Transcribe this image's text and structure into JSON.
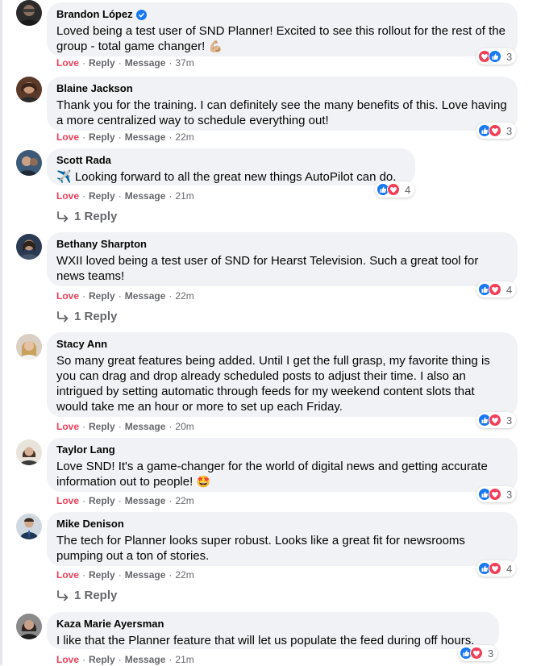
{
  "actions": {
    "love": "Love",
    "reply": "Reply",
    "message": "Message"
  },
  "comments": [
    {
      "author": "Brandon López",
      "verified": true,
      "text": "Loved being a test user of SND Planner! Excited to see this rollout for the rest of the group - total game changer!",
      "emoji": "💪🏼",
      "time": "37m",
      "reaction_order": [
        "heart",
        "like"
      ],
      "reaction_count": "3",
      "replies": ""
    },
    {
      "author": "Blaine Jackson",
      "text": "Thank you for the training. I can definitely see the many benefits of this. Love having a more centralized way to schedule everything out!",
      "time": "22m",
      "reaction_order": [
        "like",
        "heart"
      ],
      "reaction_count": "3",
      "replies": ""
    },
    {
      "author": "Scott Rada",
      "text": "✈️ Looking forward to all the great new things AutoPilot can do.",
      "time": "21m",
      "reaction_order": [
        "like",
        "heart"
      ],
      "reaction_count": "4",
      "replies": "1 Reply"
    },
    {
      "author": "Bethany Sharpton",
      "text": "WXII loved being a test user of SND for Hearst Television. Such a great tool for news teams!",
      "time": "22m",
      "reaction_order": [
        "like",
        "heart"
      ],
      "reaction_count": "4",
      "replies": "1 Reply"
    },
    {
      "author": "Stacy Ann",
      "text": "So many great features being added. Until I get the full grasp, my favorite thing is you can drag and drop already scheduled posts to adjust their time. I also an intrigued by setting automatic through feeds for my weekend content slots that would take me an hour or more to set up each Friday.",
      "time": "20m",
      "reaction_order": [
        "like",
        "heart"
      ],
      "reaction_count": "3",
      "replies": ""
    },
    {
      "author": "Taylor Lang",
      "text": "Love SND! It's a game-changer for the world of digital news and getting accurate information out to people!",
      "emoji": "🤩",
      "time": "22m",
      "reaction_order": [
        "like",
        "heart"
      ],
      "reaction_count": "3",
      "replies": ""
    },
    {
      "author": "Mike Denison",
      "text": "The tech for Planner looks super robust. Looks like a great fit for newsrooms pumping out a ton of stories.",
      "time": "22m",
      "reaction_order": [
        "like",
        "heart"
      ],
      "reaction_count": "4",
      "replies": "1 Reply"
    },
    {
      "author": "Kaza Marie Ayersman",
      "text": "I like that the Planner feature that will let us populate the feed during off hours.",
      "time": "21m",
      "reaction_order": [
        "like",
        "heart"
      ],
      "reaction_count": "3",
      "replies": ""
    }
  ],
  "colors": {
    "love": "#f33e58",
    "like": "#1877f2",
    "bubble": "#f0f2f5",
    "meta": "#65676b"
  },
  "icons": {
    "verified": "verified-badge-icon",
    "like": "like-thumb-icon",
    "heart": "heart-icon",
    "reply_arrow": "reply-arrow-icon"
  }
}
